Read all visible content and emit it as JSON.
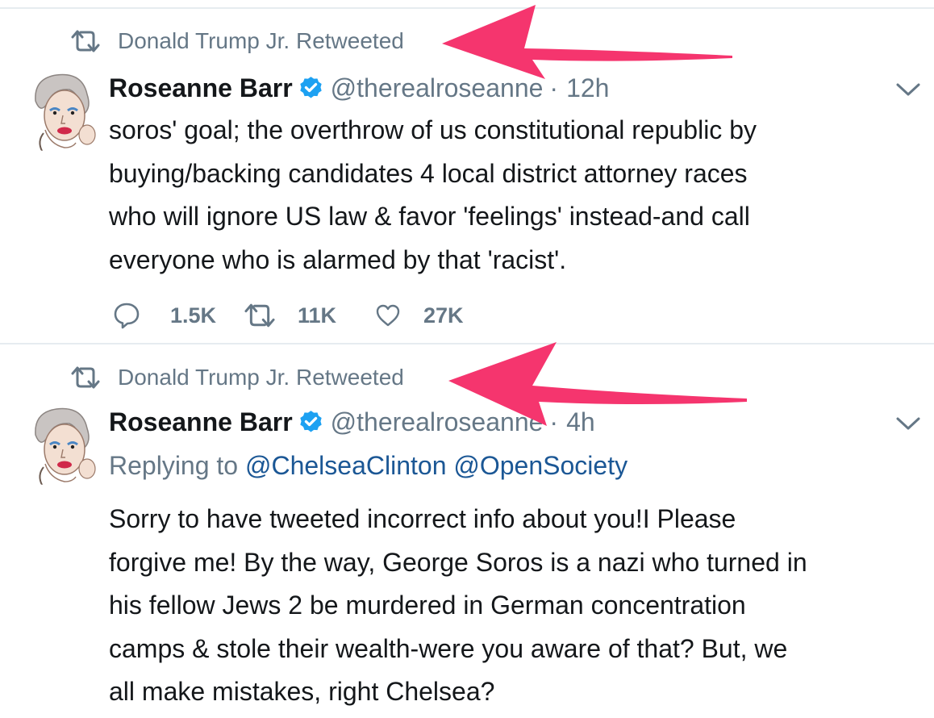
{
  "tweets": [
    {
      "retweeted_by": "Donald Trump Jr. Retweeted",
      "display_name": "Roseanne Barr",
      "handle": "@therealroseanne",
      "separator": "·",
      "time": "12h",
      "text_lines": [
        "soros' goal; the overthrow of us constitutional republic by",
        "buying/backing candidates 4 local district attorney races",
        "who will ignore US law & favor 'feelings' instead-and call",
        "everyone who is alarmed by that 'racist'."
      ],
      "replies": "1.5K",
      "retweets": "11K",
      "likes": "27K"
    },
    {
      "retweeted_by": "Donald Trump Jr. Retweeted",
      "display_name": "Roseanne Barr",
      "handle": "@therealroseanne",
      "separator": "·",
      "time": "4h",
      "replying_to_label": "Replying to",
      "mention_1": "@ChelseaClinton",
      "mention_2": "@OpenSociety",
      "text_lines": [
        "Sorry to have tweeted incorrect info about you!I Please",
        "forgive me! By the way, George Soros is a nazi who turned in",
        "his fellow Jews 2 be murdered in German concentration",
        "camps & stole their wealth-were you aware of that?  But, we",
        "all make mistakes, right Chelsea?"
      ]
    }
  ],
  "icons": {
    "retweet": "retweet-icon",
    "verified": "verified-badge-icon",
    "caret": "chevron-down-icon",
    "reply": "reply-icon",
    "like": "heart-icon",
    "annotation": "red-arrow-annotation"
  },
  "colors": {
    "text": "#14171a",
    "muted": "#657786",
    "verified_blue": "#1da1f2",
    "mention_blue": "#1b5795",
    "annotation_arrow": "#f5356e",
    "divider": "#e6ecf0"
  }
}
